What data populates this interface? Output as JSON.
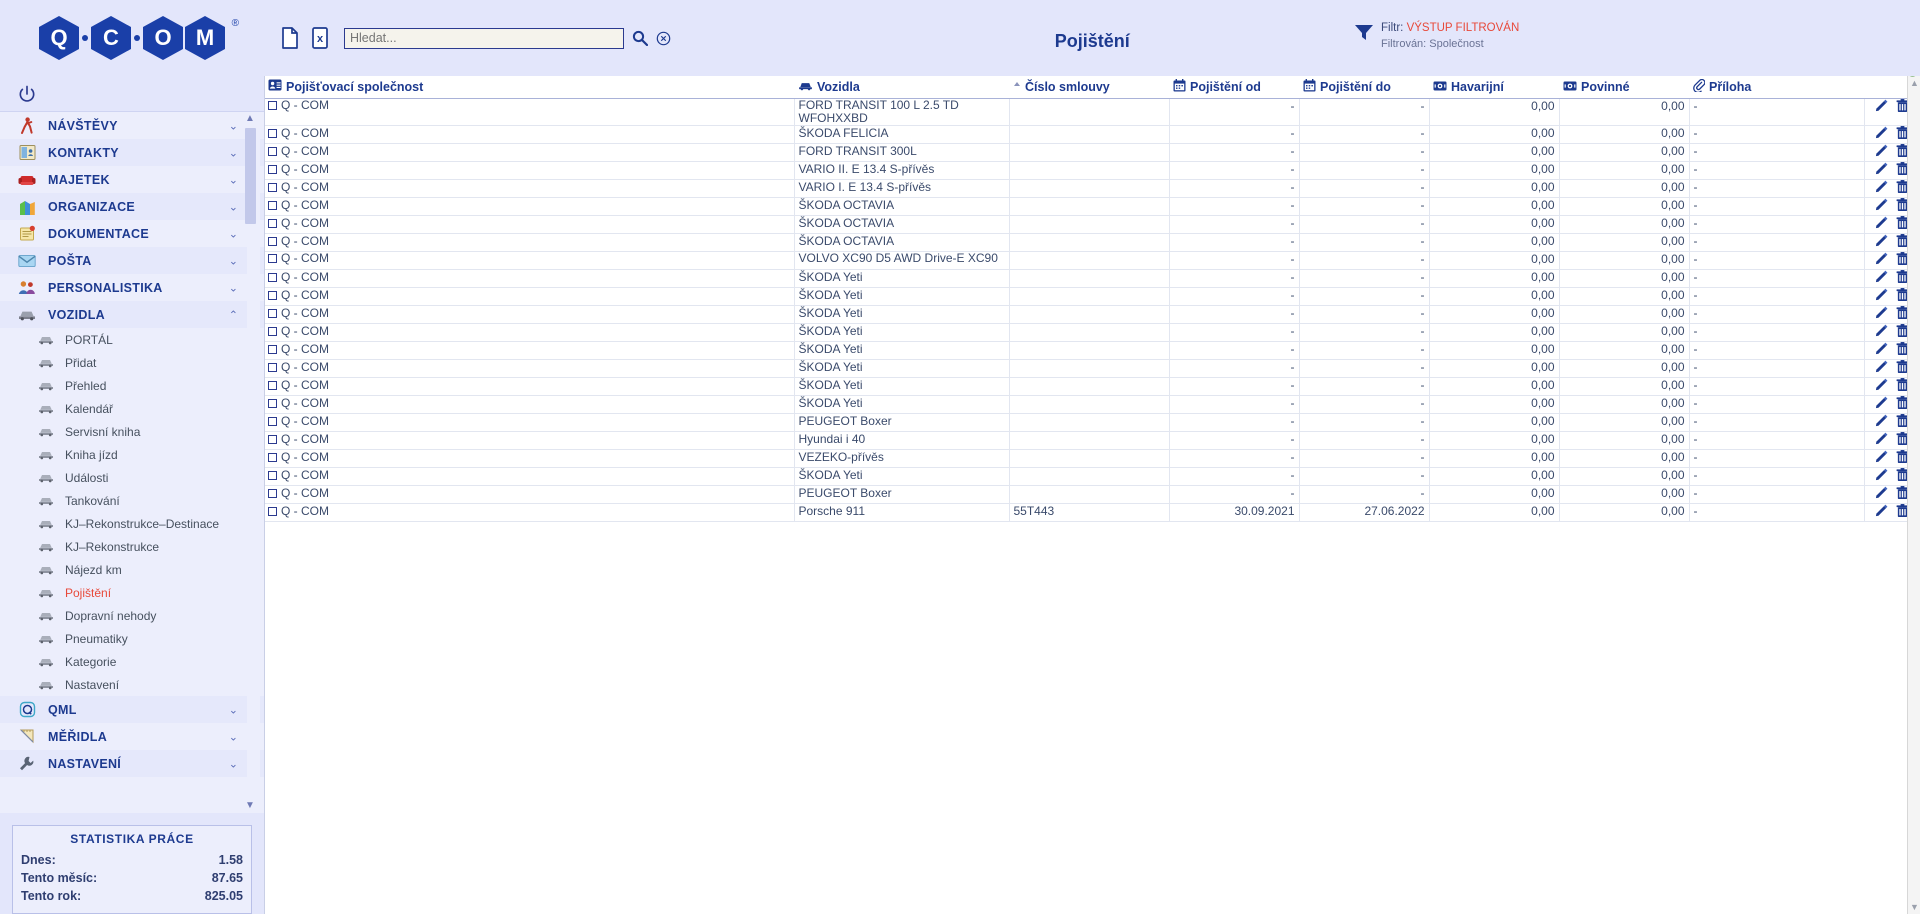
{
  "app": {
    "logo_letters": [
      "Q",
      "C",
      "O",
      "M"
    ],
    "logo_registered": "®",
    "power_icon": "power-icon"
  },
  "sidebar": {
    "groups": [
      {
        "label": "NÁVŠTĚVY",
        "icon": "walking-person-icon",
        "expanded": false
      },
      {
        "label": "KONTAKTY",
        "icon": "address-book-icon",
        "expanded": false
      },
      {
        "label": "MAJETEK",
        "icon": "armchair-icon",
        "expanded": false
      },
      {
        "label": "ORGANIZACE",
        "icon": "buildings-icon",
        "expanded": false
      },
      {
        "label": "DOKUMENTACE",
        "icon": "notepad-icon",
        "expanded": false
      },
      {
        "label": "POŠTA",
        "icon": "envelope-icon",
        "expanded": false
      },
      {
        "label": "PERSONALISTIKA",
        "icon": "people-icon",
        "expanded": false
      },
      {
        "label": "VOZIDLA",
        "icon": "car-icon",
        "expanded": true
      }
    ],
    "vozidla_items": [
      {
        "label": "PORTÁL",
        "active": false
      },
      {
        "label": "Přidat",
        "active": false
      },
      {
        "label": "Přehled",
        "active": false
      },
      {
        "label": "Kalendář",
        "active": false
      },
      {
        "label": "Servisní kniha",
        "active": false
      },
      {
        "label": "Kniha jízd",
        "active": false
      },
      {
        "label": "Události",
        "active": false
      },
      {
        "label": "Tankování",
        "active": false
      },
      {
        "label": "KJ–Rekonstrukce–Destinace",
        "active": false
      },
      {
        "label": "KJ–Rekonstrukce",
        "active": false
      },
      {
        "label": "Nájezd km",
        "active": false
      },
      {
        "label": "Pojištění",
        "active": true
      },
      {
        "label": "Dopravní nehody",
        "active": false
      },
      {
        "label": "Pneumatiky",
        "active": false
      },
      {
        "label": "Kategorie",
        "active": false
      },
      {
        "label": "Nastavení",
        "active": false
      }
    ],
    "groups_after": [
      {
        "label": "QML",
        "icon": "qml-icon",
        "expanded": false
      },
      {
        "label": "MĚŘIDLA",
        "icon": "ruler-icon",
        "expanded": false
      },
      {
        "label": "NASTAVENÍ",
        "icon": "wrench-icon",
        "expanded": false
      }
    ],
    "stats": {
      "title": "STATISTIKA PRÁCE",
      "rows": [
        {
          "label": "Dnes:",
          "value": "1.58"
        },
        {
          "label": "Tento měsíc:",
          "value": "87.65"
        },
        {
          "label": "Tento rok:",
          "value": "825.05"
        }
      ]
    }
  },
  "toolbar": {
    "new_doc_icon": "document-icon",
    "excel_icon": "excel-export-icon",
    "search_placeholder": "Hledat...",
    "search_value": "",
    "search_submit_icon": "search-icon",
    "search_clear_icon": "clear-circle-icon"
  },
  "header": {
    "title": "Pojištění",
    "filter_icon": "funnel-icon",
    "filter_label": "Filtr:",
    "filter_status": "VÝSTUP FILTROVÁN",
    "filter_detail": "Filtrován: Společnost",
    "accent_red": "#e8493a",
    "accent_blue": "#1d3a8f"
  },
  "table": {
    "columns": [
      {
        "key": "company",
        "label": "Pojišťovací společnost",
        "icon": "contact-card-icon",
        "align": "left"
      },
      {
        "key": "vehicle",
        "label": "Vozidla",
        "icon": "car-icon",
        "align": "left"
      },
      {
        "key": "contract",
        "label": "Číslo smlouvy",
        "icon": "sort-asc-icon",
        "align": "left"
      },
      {
        "key": "from",
        "label": "Pojištění od",
        "icon": "calendar-icon",
        "align": "right"
      },
      {
        "key": "to",
        "label": "Pojištění do",
        "icon": "calendar-icon",
        "align": "right"
      },
      {
        "key": "collision",
        "label": "Havarijní",
        "icon": "money-icon",
        "align": "right"
      },
      {
        "key": "mandatory",
        "label": "Povinné",
        "icon": "money-icon",
        "align": "right"
      },
      {
        "key": "attachment",
        "label": "Příloha",
        "icon": "paperclip-icon",
        "align": "left"
      }
    ],
    "row_actions": {
      "edit_icon": "pencil-icon",
      "delete_icon": "trash-icon"
    },
    "rows": [
      {
        "company": "Q - COM",
        "vehicle": "FORD TRANSIT 100 L 2.5 TD WFOHXXBD",
        "contract": "",
        "from": "-",
        "to": "-",
        "collision": "0,00",
        "mandatory": "0,00",
        "attachment": "-",
        "tall": true
      },
      {
        "company": "Q - COM",
        "vehicle": "ŠKODA FELICIA",
        "contract": "",
        "from": "-",
        "to": "-",
        "collision": "0,00",
        "mandatory": "0,00",
        "attachment": "-"
      },
      {
        "company": "Q - COM",
        "vehicle": "FORD TRANSIT 300L",
        "contract": "",
        "from": "-",
        "to": "-",
        "collision": "0,00",
        "mandatory": "0,00",
        "attachment": "-"
      },
      {
        "company": "Q - COM",
        "vehicle": "VARIO II. E 13.4 S-přívěs",
        "contract": "",
        "from": "-",
        "to": "-",
        "collision": "0,00",
        "mandatory": "0,00",
        "attachment": "-"
      },
      {
        "company": "Q - COM",
        "vehicle": "VARIO I. E 13.4 S-přívěs",
        "contract": "",
        "from": "-",
        "to": "-",
        "collision": "0,00",
        "mandatory": "0,00",
        "attachment": "-"
      },
      {
        "company": "Q - COM",
        "vehicle": "ŠKODA OCTAVIA",
        "contract": "",
        "from": "-",
        "to": "-",
        "collision": "0,00",
        "mandatory": "0,00",
        "attachment": "-"
      },
      {
        "company": "Q - COM",
        "vehicle": "ŠKODA OCTAVIA",
        "contract": "",
        "from": "-",
        "to": "-",
        "collision": "0,00",
        "mandatory": "0,00",
        "attachment": "-"
      },
      {
        "company": "Q - COM",
        "vehicle": "ŠKODA OCTAVIA",
        "contract": "",
        "from": "-",
        "to": "-",
        "collision": "0,00",
        "mandatory": "0,00",
        "attachment": "-"
      },
      {
        "company": "Q - COM",
        "vehicle": "VOLVO XC90 D5 AWD Drive-E XC90",
        "contract": "",
        "from": "-",
        "to": "-",
        "collision": "0,00",
        "mandatory": "0,00",
        "attachment": "-",
        "tall": true
      },
      {
        "company": "Q - COM",
        "vehicle": "ŠKODA Yeti",
        "contract": "",
        "from": "-",
        "to": "-",
        "collision": "0,00",
        "mandatory": "0,00",
        "attachment": "-"
      },
      {
        "company": "Q - COM",
        "vehicle": "ŠKODA Yeti",
        "contract": "",
        "from": "-",
        "to": "-",
        "collision": "0,00",
        "mandatory": "0,00",
        "attachment": "-"
      },
      {
        "company": "Q - COM",
        "vehicle": "ŠKODA Yeti",
        "contract": "",
        "from": "-",
        "to": "-",
        "collision": "0,00",
        "mandatory": "0,00",
        "attachment": "-"
      },
      {
        "company": "Q - COM",
        "vehicle": "ŠKODA Yeti",
        "contract": "",
        "from": "-",
        "to": "-",
        "collision": "0,00",
        "mandatory": "0,00",
        "attachment": "-"
      },
      {
        "company": "Q - COM",
        "vehicle": "ŠKODA Yeti",
        "contract": "",
        "from": "-",
        "to": "-",
        "collision": "0,00",
        "mandatory": "0,00",
        "attachment": "-"
      },
      {
        "company": "Q - COM",
        "vehicle": "ŠKODA Yeti",
        "contract": "",
        "from": "-",
        "to": "-",
        "collision": "0,00",
        "mandatory": "0,00",
        "attachment": "-"
      },
      {
        "company": "Q - COM",
        "vehicle": "ŠKODA Yeti",
        "contract": "",
        "from": "-",
        "to": "-",
        "collision": "0,00",
        "mandatory": "0,00",
        "attachment": "-"
      },
      {
        "company": "Q - COM",
        "vehicle": "ŠKODA Yeti",
        "contract": "",
        "from": "-",
        "to": "-",
        "collision": "0,00",
        "mandatory": "0,00",
        "attachment": "-"
      },
      {
        "company": "Q - COM",
        "vehicle": "PEUGEOT Boxer",
        "contract": "",
        "from": "-",
        "to": "-",
        "collision": "0,00",
        "mandatory": "0,00",
        "attachment": "-"
      },
      {
        "company": "Q - COM",
        "vehicle": "Hyundai i 40",
        "contract": "",
        "from": "-",
        "to": "-",
        "collision": "0,00",
        "mandatory": "0,00",
        "attachment": "-"
      },
      {
        "company": "Q - COM",
        "vehicle": "VEZEKO-přívěs",
        "contract": "",
        "from": "-",
        "to": "-",
        "collision": "0,00",
        "mandatory": "0,00",
        "attachment": "-"
      },
      {
        "company": "Q - COM",
        "vehicle": "ŠKODA Yeti",
        "contract": "",
        "from": "-",
        "to": "-",
        "collision": "0,00",
        "mandatory": "0,00",
        "attachment": "-"
      },
      {
        "company": "Q - COM",
        "vehicle": "PEUGEOT Boxer",
        "contract": "",
        "from": "-",
        "to": "-",
        "collision": "0,00",
        "mandatory": "0,00",
        "attachment": "-"
      },
      {
        "company": "Q - COM",
        "vehicle": "Porsche 911",
        "contract": "55T443",
        "from": "30.09.2021",
        "to": "27.06.2022",
        "collision": "0,00",
        "mandatory": "0,00",
        "attachment": "-"
      }
    ]
  },
  "scrollbars": {
    "up_arrow": "▲",
    "down_arrow": "▼",
    "clock_icon": "clock-icon"
  }
}
